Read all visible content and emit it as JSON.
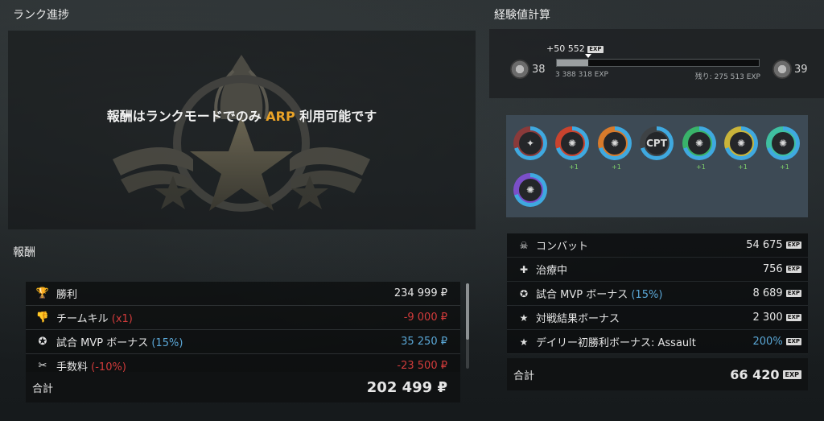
{
  "rank_progress": {
    "title": "ランク進捗",
    "message_before": "報酬はランクモードでのみ",
    "message_highlight": "ARP",
    "message_after": "利用可能です"
  },
  "rewards": {
    "title": "報酬",
    "rows": [
      {
        "icon": "trophy-icon",
        "label": "勝利",
        "modifier": "",
        "value": "234 999 ₽",
        "tone": "pos"
      },
      {
        "icon": "thumbs-down-icon",
        "label": "チームキル",
        "modifier": "(x1)",
        "value": "-9 000 ₽",
        "tone": "neg"
      },
      {
        "icon": "mvp-medal-icon",
        "label": "試合 MVP ボーナス",
        "modifier": "(15%)",
        "value": "35 250 ₽",
        "tone": "blue"
      },
      {
        "icon": "fee-icon",
        "label": "手数料",
        "modifier": "(-10%)",
        "value": "-23 500 ₽",
        "tone": "neg"
      }
    ],
    "total_label": "合計",
    "total_value": "202 499 ₽"
  },
  "exp_calc": {
    "title": "経験値計算",
    "current_level": "38",
    "next_level": "39",
    "gain": "+50 552",
    "exp_tag": "EXP",
    "current_exp": "3 388 318 EXP",
    "remaining": "残り: 275 513 EXP",
    "progress_fraction": 0.155,
    "medals": [
      {
        "name": "weapon-medal-icon",
        "glyph": "✦",
        "ring": "#8a3a3a",
        "plus": ""
      },
      {
        "name": "grenade-medal-red-icon",
        "glyph": "✺",
        "ring": "#c9432e",
        "plus": "+1"
      },
      {
        "name": "grenade-medal-orange-icon",
        "glyph": "✺",
        "ring": "#d77a2b",
        "plus": "+1"
      },
      {
        "name": "cpt-medal-icon",
        "glyph": "CPT",
        "ring": "#3e4245",
        "plus": ""
      },
      {
        "name": "grenade-medal-green-icon",
        "glyph": "✺",
        "ring": "#39b36a",
        "plus": "+1"
      },
      {
        "name": "grenade-medal-yellow-icon",
        "glyph": "✺",
        "ring": "#c9b43a",
        "plus": "+1"
      },
      {
        "name": "grenade-medal-teal-icon",
        "glyph": "✺",
        "ring": "#3fbfa0",
        "plus": "+1"
      },
      {
        "name": "grenade-medal-purple-icon",
        "glyph": "✺",
        "ring": "#7b4fc9",
        "plus": ""
      }
    ],
    "rows": [
      {
        "icon": "skull-icon",
        "glyph": "☠",
        "label": "コンバット",
        "modifier": "",
        "value": "54 675",
        "tone": ""
      },
      {
        "icon": "heal-icon",
        "glyph": "✚",
        "label": "治療中",
        "modifier": "",
        "value": "756",
        "tone": ""
      },
      {
        "icon": "mvp-medal-icon",
        "glyph": "✪",
        "label": "試合 MVP ボーナス",
        "modifier": "(15%)",
        "value": "8 689",
        "tone": ""
      },
      {
        "icon": "star-icon",
        "glyph": "★",
        "label": "対戦結果ボーナス",
        "modifier": "",
        "value": "2 300",
        "tone": ""
      },
      {
        "icon": "star-icon",
        "glyph": "★",
        "label": "デイリー初勝利ボーナス: Assault",
        "modifier": "",
        "value": "200%",
        "tone": "blue"
      }
    ],
    "total_label": "合計",
    "total_value": "66 420"
  }
}
